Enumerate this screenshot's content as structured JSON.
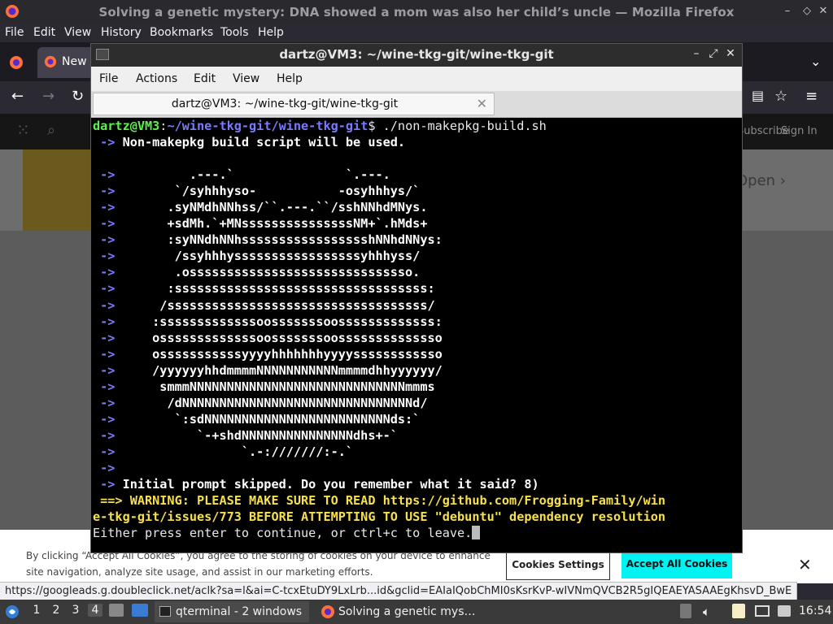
{
  "firefox": {
    "title": "Solving a genetic mystery: DNA showed a mom was also her child’s uncle — Mozilla Firefox",
    "menu": [
      "File",
      "Edit",
      "View",
      "History",
      "Bookmarks",
      "Tools",
      "Help"
    ],
    "tab_label": "New",
    "site": {
      "header_right": [
        "Subscribe",
        "Sign In"
      ],
      "open_label": "Open"
    },
    "cookie": {
      "text": "By clicking “Accept All Cookies”, you agree to the storing of cookies on your device to enhance site navigation, analyze site usage, and assist in our marketing efforts.",
      "settings_label": "Cookies Settings",
      "accept_label": "Accept All Cookies",
      "close": "✕"
    },
    "status_url": "https://googleads.g.doubleclick.net/aclk?sa=l&ai=C-tcxEtuDY9LxLrb...id&gclid=EAIaIQobChMI0sKsrKvP-wIVNmQVCB2R5gIQEAEYASAAEgKhsvD_BwE"
  },
  "terminal": {
    "title": "dartz@VM3: ~/wine-tkg-git/wine-tkg-git",
    "menu": [
      "File",
      "Actions",
      "Edit",
      "View",
      "Help"
    ],
    "tab_label": "dartz@VM3: ~/wine-tkg-git/wine-tkg-git",
    "prompt_user": "dartz@VM3",
    "prompt_sep": ":",
    "prompt_path": "~/wine-tkg-git/wine-tkg-git",
    "prompt_end": "$ ",
    "command": "./non-makepkg-build.sh",
    "arrow": " ->",
    "line_banner": " Non-makepkg build script will be used.",
    "art": [
      "        .---.`               `.---.",
      "      `/syhhhyso-           -osyhhhys/`",
      "     .syNMdhNNhss/``.---.``/sshNNhdMNys.",
      "     +sdMh.`+MNsssssssssssssssNM+`.hMds+",
      "     :syNNdhNNhssssssssssssssssshNNhdNNys:",
      "      /ssyhhhysssssssssssssssssyhhhyss/",
      "      .ossssssssssssssssssssssssssssso.",
      "     :ssssssssssssssssssssssssssssssssss:",
      "    /sssssssssssssssssssssssssssssssssss/",
      "   :sssssssssssssoosssssssoosssssssssssss:",
      "   osssssssssssssoosssssssoossssssssssssso",
      "   osssssssssssyyyyhhhhhhhyyyyssssssssssso",
      "   /yyyyyyhhdmmmmNNNNNNNNNNNmmmmdhhyyyyyy/",
      "    smmmNNNNNNNNNNNNNNNNNNNNNNNNNNNNNmmms",
      "     /dNNNNNNNNNNNNNNNNNNNNNNNNNNNNNNNd/",
      "      `:sdNNNNNNNNNNNNNNNNNNNNNNNNNds:`",
      "         `-+shdNNNNNNNNNNNNNNNdhs+-`",
      "               `.-:///////:-.`",
      ""
    ],
    "line_skipped": " Initial prompt skipped. Do you remember what it said? 8)",
    "warning_1": " ==> WARNING: PLEASE MAKE SURE TO READ https://github.com/Frogging-Family/win",
    "warning_2": "e-tkg-git/issues/773 BEFORE ATTEMPTING TO USE \"debuntu\" dependency resolution",
    "continue_prompt": "Either press enter to continue, or ctrl+c to leave."
  },
  "panel": {
    "workspaces": [
      "1",
      "2",
      "3",
      "4"
    ],
    "active_workspace": "4",
    "task_terminal": "qterminal - 2 windows",
    "task_firefox": "Solving a genetic mys…",
    "clock": "16:54"
  },
  "colors": {
    "prompt_green": "#5cf24a",
    "arrow_blue": "#7a7aff",
    "warning_yellow": "#f7e04a",
    "cookie_accept": "#00f2f2"
  }
}
